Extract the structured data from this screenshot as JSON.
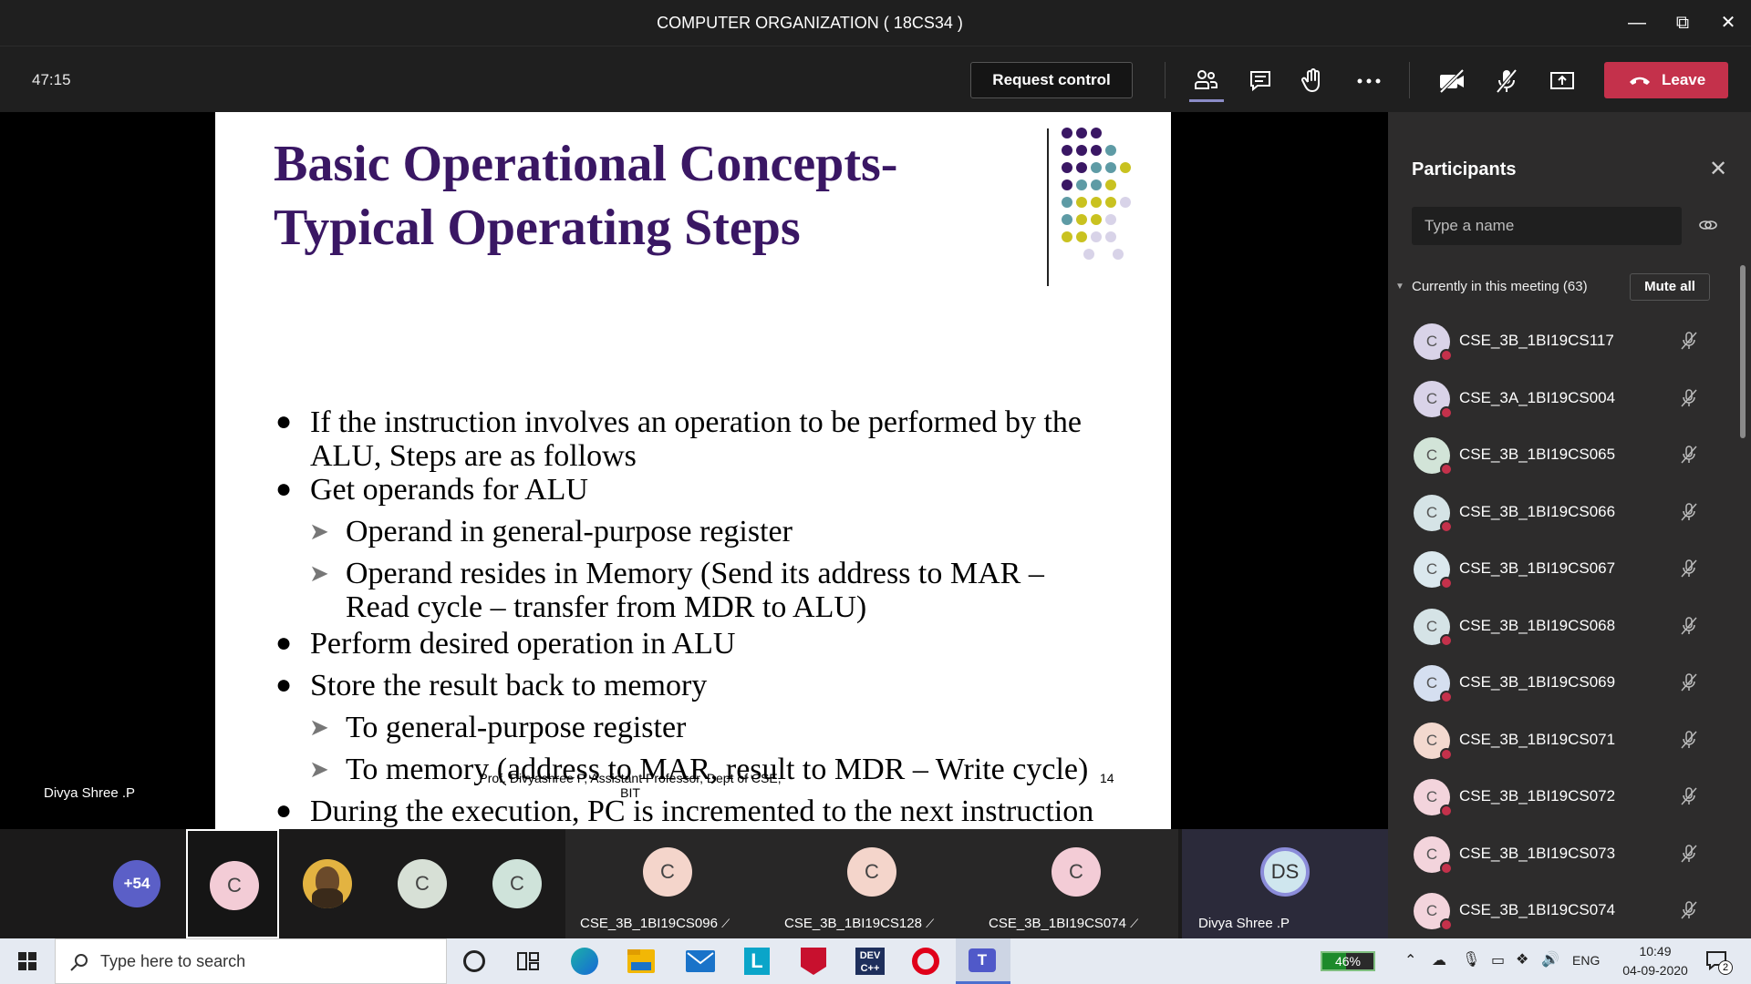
{
  "window": {
    "title": "COMPUTER ORGANIZATION ( 18CS34 )"
  },
  "toolbar": {
    "timer": "47:15",
    "request_control": "Request control",
    "leave": "Leave"
  },
  "slide": {
    "title_line1": "Basic Operational Concepts-",
    "title_line2": "Typical Operating Steps",
    "bullets": [
      "If the instruction involves an operation to be performed by the",
      "ALU, Steps are as follows",
      "Get operands for ALU",
      "Operand in general-purpose register",
      "Operand resides in Memory (Send its address to MAR –",
      "Read cycle – transfer from MDR to ALU)",
      "Perform desired operation in ALU",
      "Store the result back to memory",
      "To general-purpose register",
      "To memory (address to MAR, result to MDR – Write cycle)",
      "During the execution, PC is incremented to the next instruction"
    ],
    "footer_line1": "Prof. Divyashree P, Assistant Professor, Dept of CSE,",
    "footer_line2": "BIT",
    "page_number": "14"
  },
  "presenter_name": "Divya Shree .P",
  "participants_panel": {
    "title": "Participants",
    "search_placeholder": "Type a name",
    "currently_label": "Currently in this meeting (63)",
    "mute_all": "Mute all",
    "participants": [
      {
        "initial": "C",
        "name": "CSE_3B_1BI19CS117",
        "color": "#d9d3e8"
      },
      {
        "initial": "C",
        "name": "CSE_3A_1BI19CS004",
        "color": "#d9d3e8"
      },
      {
        "initial": "C",
        "name": "CSE_3B_1BI19CS065",
        "color": "#d2e4d8"
      },
      {
        "initial": "C",
        "name": "CSE_3B_1BI19CS066",
        "color": "#d5e3e6"
      },
      {
        "initial": "C",
        "name": "CSE_3B_1BI19CS067",
        "color": "#dbe8ee"
      },
      {
        "initial": "C",
        "name": "CSE_3B_1BI19CS068",
        "color": "#d5e3e6"
      },
      {
        "initial": "C",
        "name": "CSE_3B_1BI19CS069",
        "color": "#d5dff0"
      },
      {
        "initial": "C",
        "name": "CSE_3B_1BI19CS071",
        "color": "#f3d9cf"
      },
      {
        "initial": "C",
        "name": "CSE_3B_1BI19CS072",
        "color": "#f3d4dc"
      },
      {
        "initial": "C",
        "name": "CSE_3B_1BI19CS073",
        "color": "#f3d4dc"
      },
      {
        "initial": "C",
        "name": "CSE_3B_1BI19CS074",
        "color": "#f3d4dc"
      }
    ]
  },
  "strip": {
    "overflow_count": "+54",
    "tiles": [
      {
        "initial": "C",
        "label": "",
        "color": "#f3ccd6"
      },
      {
        "initial": "",
        "label": "",
        "color": "#e3b341"
      },
      {
        "initial": "C",
        "label": "",
        "color": "#d7e0d6"
      },
      {
        "initial": "C",
        "label": "",
        "color": "#cfe3da"
      },
      {
        "initial": "C",
        "label": "CSE_3B_1BI19CS096",
        "color": "#f4d5cb"
      },
      {
        "initial": "C",
        "label": "CSE_3B_1BI19CS128",
        "color": "#f4d5cb"
      },
      {
        "initial": "C",
        "label": "CSE_3B_1BI19CS074",
        "color": "#f3ccd6"
      },
      {
        "initial": "DS",
        "label": "Divya Shree .P",
        "color": "#cfe6ee"
      }
    ]
  },
  "taskbar": {
    "search_placeholder": "Type here to search",
    "battery": "46%",
    "language": "ENG",
    "time": "10:49",
    "date": "04-09-2020",
    "notifications": "2"
  },
  "colors": {
    "title_purple": "#3a1764",
    "leave_red": "#c4314b",
    "panel_bg": "#2d2c2c"
  }
}
